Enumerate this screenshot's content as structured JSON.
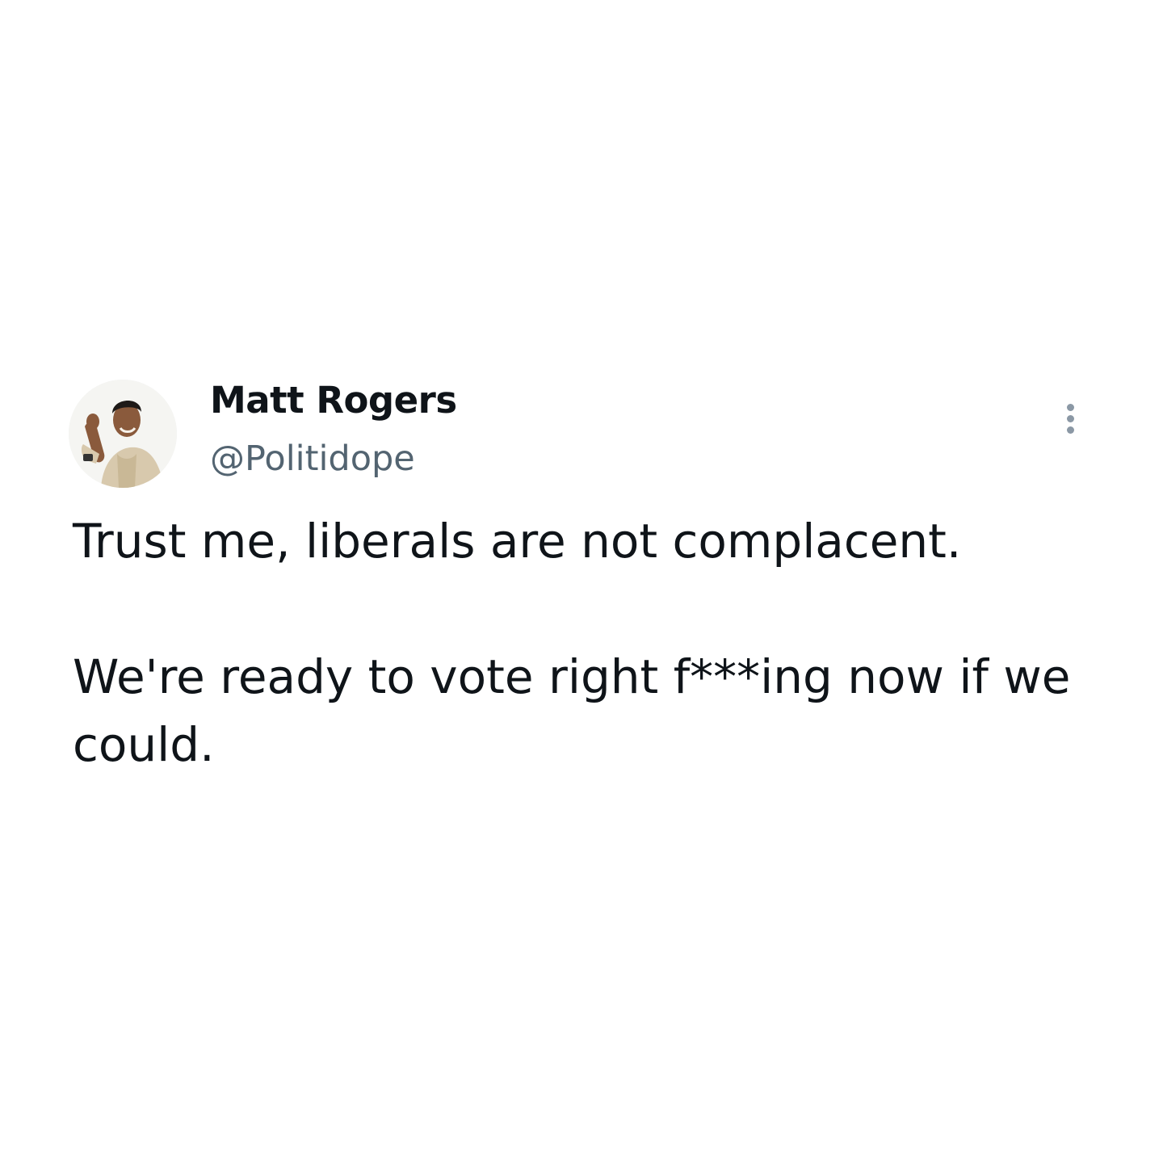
{
  "tweet": {
    "author_name": "Matt Rogers",
    "author_handle": "@Politidope",
    "paragraphs": [
      "Trust me, liberals are not complacent.",
      "We're ready to vote right f***ing now if we could."
    ],
    "avatar_icon": "profile-photo",
    "more_icon": "more-vertical-icon"
  },
  "colors": {
    "text": "#0f1419",
    "secondary": "#536471",
    "background": "#ffffff"
  }
}
